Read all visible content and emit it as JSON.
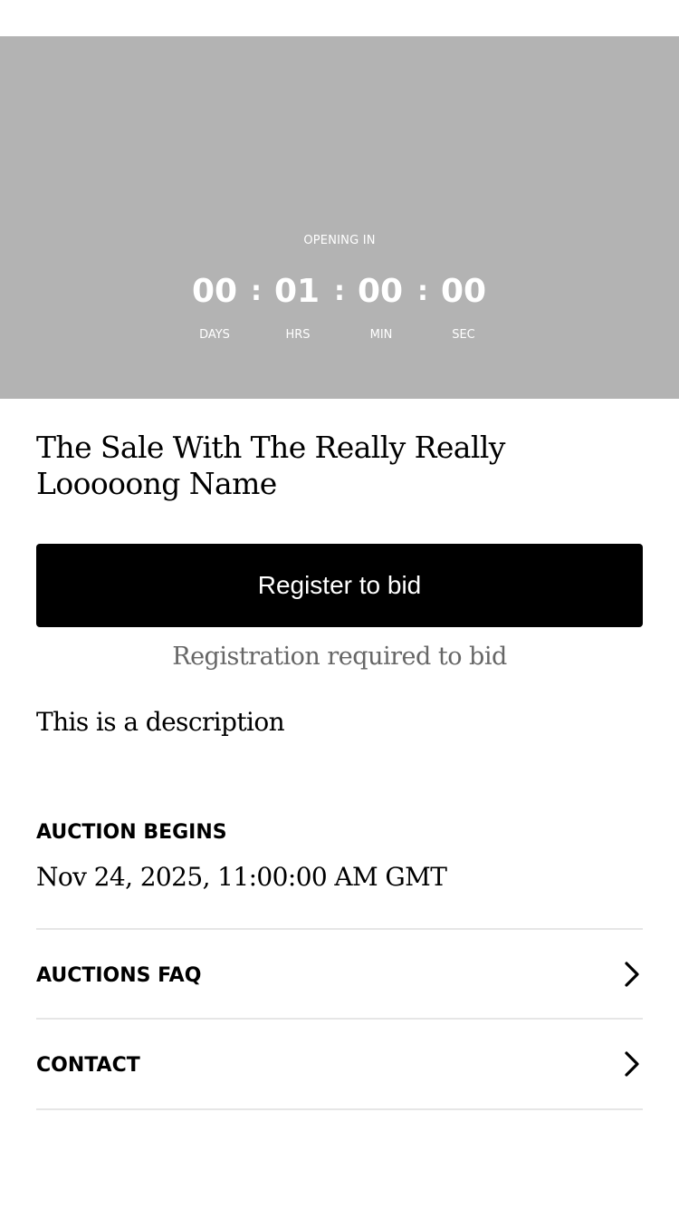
{
  "hero": {
    "opening_label": "OPENING IN",
    "countdown": {
      "days": "00",
      "hours": "01",
      "minutes": "00",
      "seconds": "00",
      "separator": ":",
      "days_label": "DAYS",
      "hours_label": "HRS",
      "minutes_label": "MIN",
      "seconds_label": "SEC"
    }
  },
  "sale": {
    "title": "The Sale With The Really Really Looooong Name",
    "register_label": "Register to bid",
    "registration_note": "Registration required to bid",
    "description": "This is a description",
    "begins_label": "AUCTION BEGINS",
    "begins_value": "Nov 24, 2025, 11:00:00 AM GMT"
  },
  "links": [
    {
      "label": "AUCTIONS FAQ",
      "icon": "chevron-right-icon"
    },
    {
      "label": "CONTACT",
      "icon": "chevron-right-icon"
    }
  ],
  "colors": {
    "hero_background": "#b3b3b3",
    "button_background": "#000000",
    "muted_text": "#666666",
    "divider": "#e6e6e6"
  }
}
